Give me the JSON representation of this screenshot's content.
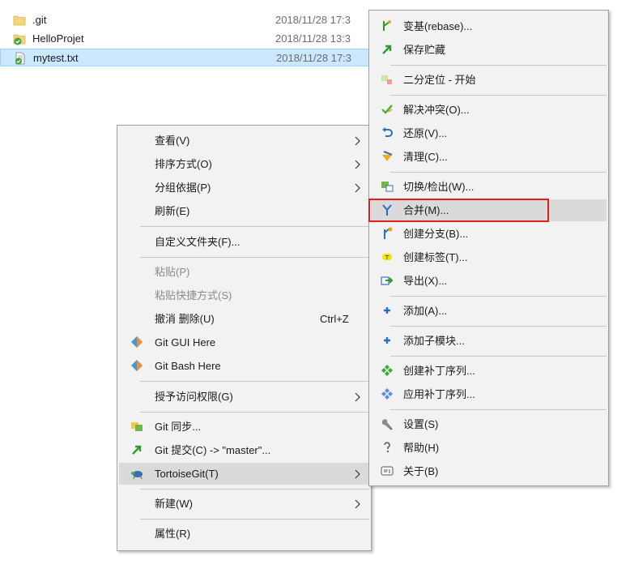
{
  "files": [
    {
      "name": ".git",
      "date": "2018/11/28 17:3",
      "icon": "folder-icon"
    },
    {
      "name": "HelloProjet",
      "date": "2018/11/28 13:3",
      "icon": "git-folder-icon"
    },
    {
      "name": "mytest.txt",
      "date": "2018/11/28 17:3",
      "icon": "git-file-icon"
    }
  ],
  "context_menu": {
    "items": {
      "view": "查看(V)",
      "sort": "排序方式(O)",
      "group": "分组依据(P)",
      "refresh": "刷新(E)",
      "customize": "自定义文件夹(F)...",
      "paste": "粘贴(P)",
      "paste_shortcut": "粘贴快捷方式(S)",
      "undo": "撤消 删除(U)",
      "undo_shortcut": "Ctrl+Z",
      "git_gui": "Git GUI Here",
      "git_bash": "Git Bash Here",
      "grant_access": "授予访问权限(G)",
      "git_sync": "Git 同步...",
      "git_commit": "Git 提交(C) -> \"master\"...",
      "tortoisegit": "TortoiseGit(T)",
      "new": "新建(W)",
      "properties": "属性(R)"
    }
  },
  "submenu": {
    "items": {
      "rebase": "变基(rebase)...",
      "stash": "保存贮藏",
      "bisect": "二分定位 - 开始",
      "resolve": "解决冲突(O)...",
      "revert": "还原(V)...",
      "cleanup": "清理(C)...",
      "switch": "切换/检出(W)...",
      "merge": "合并(M)...",
      "branch": "创建分支(B)...",
      "tag": "创建标签(T)...",
      "export": "导出(X)...",
      "add": "添加(A)...",
      "add_submodule": "添加子模块...",
      "create_patch": "创建补丁序列...",
      "apply_patch": "应用补丁序列...",
      "settings": "设置(S)",
      "help": "帮助(H)",
      "about": "关于(B)"
    }
  }
}
